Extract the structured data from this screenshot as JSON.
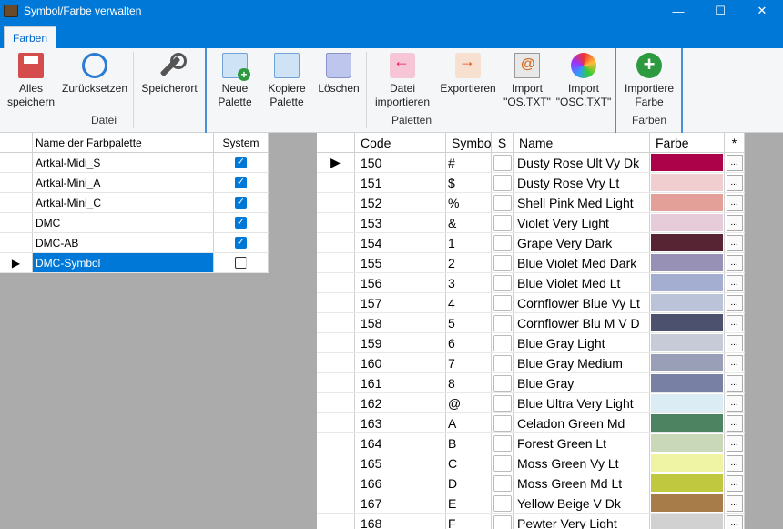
{
  "window": {
    "title": "Symbol/Farbe verwalten",
    "minimize": "—",
    "maximize": "☐",
    "close": "✕"
  },
  "ribbon": {
    "tab": "Farben",
    "buttons": {
      "save_all": "Alles\nspeichern",
      "reset": "Zurücksetzen",
      "save_location": "Speicherort",
      "new_palette": "Neue\nPalette",
      "copy_palette": "Kopiere\nPalette",
      "delete": "Löschen",
      "import_file": "Datei\nimportieren",
      "export": "Exportieren",
      "import_os": "Import\n\"OS.TXT\"",
      "import_osc": "Import\n\"OSC.TXT\"",
      "import_color": "Importiere\nFarbe"
    },
    "groups": {
      "file": "Datei",
      "palettes": "Paletten",
      "colors": "Farben"
    }
  },
  "palette_grid": {
    "headers": {
      "name": "Name der Farbpalette",
      "system": "System"
    },
    "rows": [
      {
        "name": "Artkal-Midi_S",
        "system": true
      },
      {
        "name": "Artkal-Mini_A",
        "system": true
      },
      {
        "name": "Artkal-Mini_C",
        "system": true
      },
      {
        "name": "DMC",
        "system": true
      },
      {
        "name": "DMC-AB",
        "system": true
      },
      {
        "name": "DMC-Symbol",
        "system": false
      }
    ],
    "selected_index": 5
  },
  "color_grid": {
    "headers": {
      "code": "Code",
      "symbol": "Symbo",
      "s": "S",
      "name": "Name",
      "farbe": "Farbe",
      "star": "*"
    },
    "button_label": "...",
    "rows": [
      {
        "code": "150",
        "symbol": "#",
        "name": "Dusty Rose Ult Vy Dk",
        "color": "#ab0249"
      },
      {
        "code": "151",
        "symbol": "$",
        "name": "Dusty Rose Vry Lt",
        "color": "#f0cecf"
      },
      {
        "code": "152",
        "symbol": "%",
        "name": "Shell Pink Med Light",
        "color": "#e2a099"
      },
      {
        "code": "153",
        "symbol": "&",
        "name": "Violet Very Light",
        "color": "#e6ccd9"
      },
      {
        "code": "154",
        "symbol": "1",
        "name": "Grape Very Dark",
        "color": "#572433"
      },
      {
        "code": "155",
        "symbol": "2",
        "name": "Blue Violet Med Dark",
        "color": "#9891b6"
      },
      {
        "code": "156",
        "symbol": "3",
        "name": "Blue Violet Med Lt",
        "color": "#a3aed1"
      },
      {
        "code": "157",
        "symbol": "4",
        "name": "Cornflower Blue Vy Lt",
        "color": "#bbc3d9"
      },
      {
        "code": "158",
        "symbol": "5",
        "name": "Cornflower Blu M V D",
        "color": "#4c526e"
      },
      {
        "code": "159",
        "symbol": "6",
        "name": "Blue Gray Light",
        "color": "#c7cad7"
      },
      {
        "code": "160",
        "symbol": "7",
        "name": "Blue Gray Medium",
        "color": "#999fb7"
      },
      {
        "code": "161",
        "symbol": "8",
        "name": "Blue Gray",
        "color": "#7880a4"
      },
      {
        "code": "162",
        "symbol": "@",
        "name": "Blue Ultra Very Light",
        "color": "#dbecf5"
      },
      {
        "code": "163",
        "symbol": "A",
        "name": "Celadon Green Md",
        "color": "#4d8361"
      },
      {
        "code": "164",
        "symbol": "B",
        "name": "Forest Green Lt",
        "color": "#c8d8b8"
      },
      {
        "code": "165",
        "symbol": "C",
        "name": "Moss Green Vy Lt",
        "color": "#eff4a4"
      },
      {
        "code": "166",
        "symbol": "D",
        "name": "Moss Green Md Lt",
        "color": "#c0c840"
      },
      {
        "code": "167",
        "symbol": "E",
        "name": "Yellow Beige V Dk",
        "color": "#a77c49"
      },
      {
        "code": "168",
        "symbol": "F",
        "name": "Pewter Very Light",
        "color": "#d1d1d1"
      }
    ],
    "current_row_index": 0
  }
}
